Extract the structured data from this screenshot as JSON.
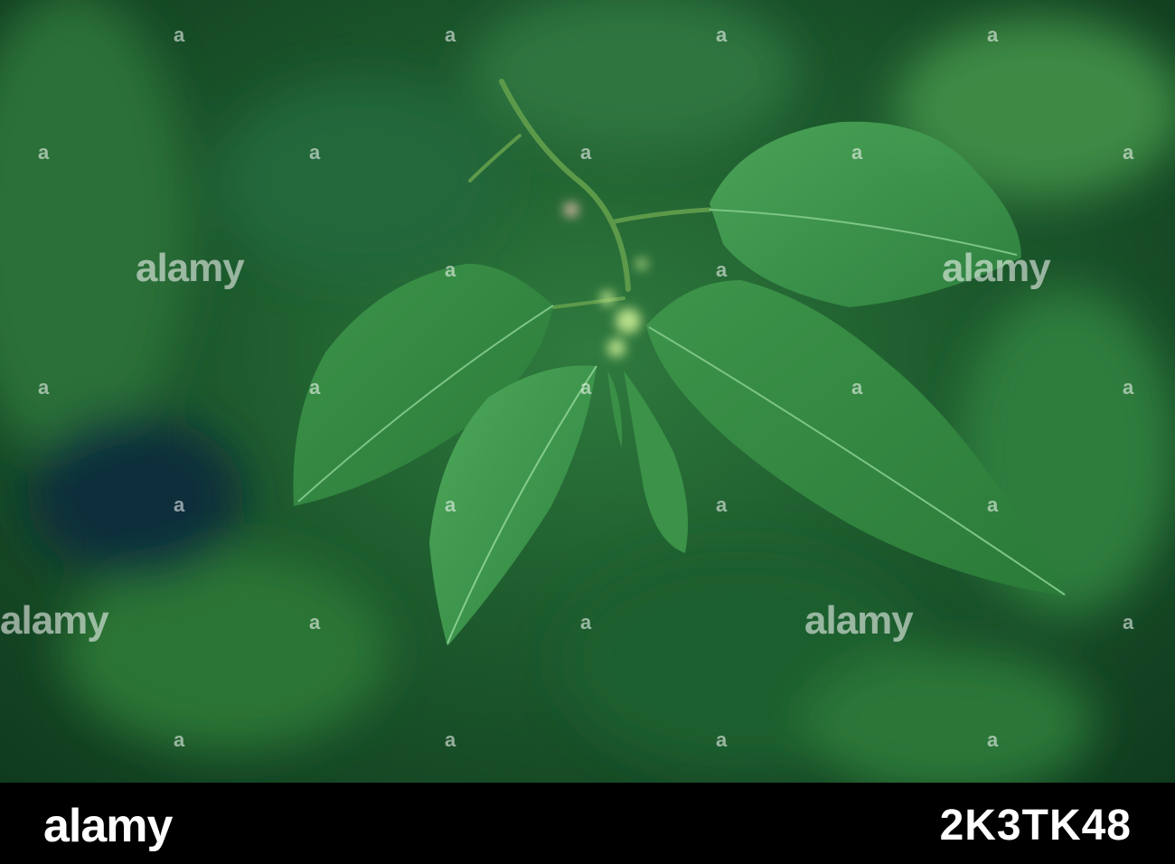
{
  "watermark": {
    "word": "alamy",
    "mark": "a"
  },
  "footer": {
    "logo": "alamy",
    "image_id": "2K3TK48"
  },
  "colors": {
    "leaf": "#3f9a4a",
    "leaf_light": "#5fb868",
    "background": "#1d5a2d",
    "footer": "#000000"
  }
}
